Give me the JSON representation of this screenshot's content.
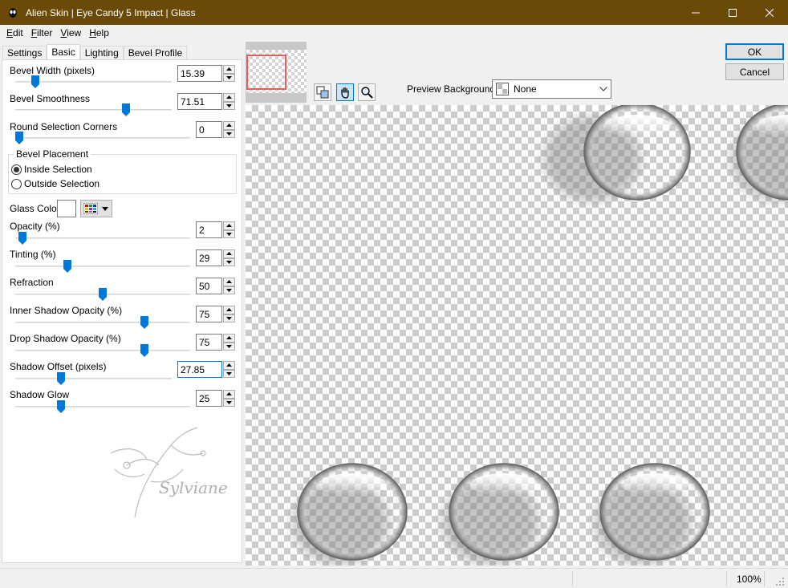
{
  "window": {
    "title": "Alien Skin | Eye Candy 5 Impact | Glass",
    "titlebar_color": "#6b4a07"
  },
  "menu": [
    {
      "pre": "",
      "u": "E",
      "post": "dit"
    },
    {
      "pre": "",
      "u": "F",
      "post": "ilter"
    },
    {
      "pre": "",
      "u": "V",
      "post": "iew"
    },
    {
      "pre": "",
      "u": "H",
      "post": "elp"
    }
  ],
  "tabs": {
    "settings": "Settings",
    "basic": "Basic",
    "lighting": "Lighting",
    "bevel_profile": "Bevel Profile",
    "active": "Basic"
  },
  "controls": {
    "bevel_width": {
      "label": "Bevel Width (pixels)",
      "value": "15.39",
      "level": 0.11
    },
    "bevel_smoothness": {
      "label": "Bevel Smoothness",
      "value": "71.51",
      "level": 0.72
    },
    "round_corners": {
      "label": "Round Selection Corners",
      "value": "0",
      "level": 0.0
    },
    "bevel_placement": {
      "legend": "Bevel Placement",
      "inside": "Inside Selection",
      "outside": "Outside Selection",
      "selected": "Inside Selection"
    },
    "glass_color": {
      "label": "Glass Color",
      "color": "#ffffff"
    },
    "opacity": {
      "label": "Opacity (%)",
      "value": "2",
      "level": 0.02
    },
    "tinting": {
      "label": "Tinting (%)",
      "value": "29",
      "level": 0.29
    },
    "refraction": {
      "label": "Refraction",
      "value": "50",
      "level": 0.5
    },
    "inner_shadow_opacity": {
      "label": "Inner Shadow Opacity (%)",
      "value": "75",
      "level": 0.75
    },
    "drop_shadow_opacity": {
      "label": "Drop Shadow Opacity (%)",
      "value": "75",
      "level": 0.75
    },
    "shadow_offset": {
      "label": "Shadow Offset (pixels)",
      "value": "27.85",
      "level": 0.28
    },
    "shadow_glow": {
      "label": "Shadow Glow",
      "value": "25",
      "level": 0.25
    }
  },
  "watermark": "Sylviane",
  "preview": {
    "background_label": "Preview Background:",
    "background_value": "None"
  },
  "buttons": {
    "ok": "OK",
    "cancel": "Cancel"
  },
  "status": {
    "zoom": "100%"
  },
  "accent_color": "#0078d7"
}
